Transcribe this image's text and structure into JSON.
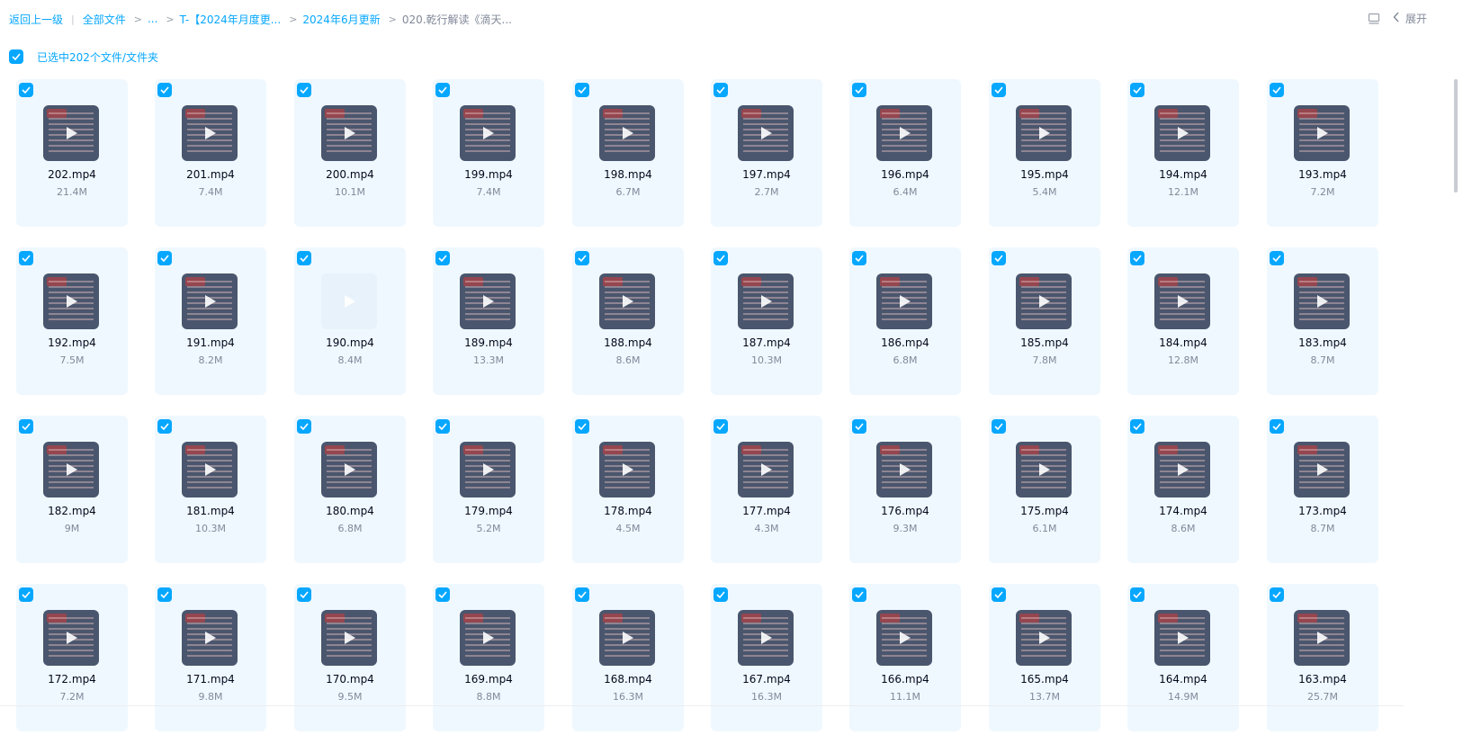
{
  "breadcrumb": {
    "back": "返回上一级",
    "root": "全部文件",
    "ellipsis": "...",
    "crumb1": "T-【2024年月度更...",
    "crumb2": "2024年6月更新",
    "current": "020.乾行解读《滴天..."
  },
  "toolbar": {
    "expand_label": "展开",
    "view_icon": "list-view-icon",
    "collapse_icon": "chevron-left-icon"
  },
  "selection": {
    "label": "已选中202个文件/文件夹"
  },
  "colors": {
    "accent": "#06a7ff",
    "card_bg": "#eff8ff",
    "thumb_bg": "#4a566d"
  },
  "files": [
    {
      "name": "202.mp4",
      "size": "21.4M"
    },
    {
      "name": "201.mp4",
      "size": "7.4M"
    },
    {
      "name": "200.mp4",
      "size": "10.1M"
    },
    {
      "name": "199.mp4",
      "size": "7.4M"
    },
    {
      "name": "198.mp4",
      "size": "6.7M"
    },
    {
      "name": "197.mp4",
      "size": "2.7M"
    },
    {
      "name": "196.mp4",
      "size": "6.4M"
    },
    {
      "name": "195.mp4",
      "size": "5.4M"
    },
    {
      "name": "194.mp4",
      "size": "12.1M"
    },
    {
      "name": "193.mp4",
      "size": "7.2M"
    },
    {
      "name": "192.mp4",
      "size": "7.5M"
    },
    {
      "name": "191.mp4",
      "size": "8.2M"
    },
    {
      "name": "190.mp4",
      "size": "8.4M",
      "no_preview": true
    },
    {
      "name": "189.mp4",
      "size": "13.3M"
    },
    {
      "name": "188.mp4",
      "size": "8.6M"
    },
    {
      "name": "187.mp4",
      "size": "10.3M"
    },
    {
      "name": "186.mp4",
      "size": "6.8M"
    },
    {
      "name": "185.mp4",
      "size": "7.8M"
    },
    {
      "name": "184.mp4",
      "size": "12.8M"
    },
    {
      "name": "183.mp4",
      "size": "8.7M"
    },
    {
      "name": "182.mp4",
      "size": "9M"
    },
    {
      "name": "181.mp4",
      "size": "10.3M"
    },
    {
      "name": "180.mp4",
      "size": "6.8M"
    },
    {
      "name": "179.mp4",
      "size": "5.2M"
    },
    {
      "name": "178.mp4",
      "size": "4.5M"
    },
    {
      "name": "177.mp4",
      "size": "4.3M"
    },
    {
      "name": "176.mp4",
      "size": "9.3M"
    },
    {
      "name": "175.mp4",
      "size": "6.1M"
    },
    {
      "name": "174.mp4",
      "size": "8.6M"
    },
    {
      "name": "173.mp4",
      "size": "8.7M"
    },
    {
      "name": "172.mp4",
      "size": "7.2M"
    },
    {
      "name": "171.mp4",
      "size": "9.8M"
    },
    {
      "name": "170.mp4",
      "size": "9.5M"
    },
    {
      "name": "169.mp4",
      "size": "8.8M"
    },
    {
      "name": "168.mp4",
      "size": "16.3M"
    },
    {
      "name": "167.mp4",
      "size": "16.3M"
    },
    {
      "name": "166.mp4",
      "size": "11.1M"
    },
    {
      "name": "165.mp4",
      "size": "13.7M"
    },
    {
      "name": "164.mp4",
      "size": "14.9M"
    },
    {
      "name": "163.mp4",
      "size": "25.7M"
    }
  ]
}
